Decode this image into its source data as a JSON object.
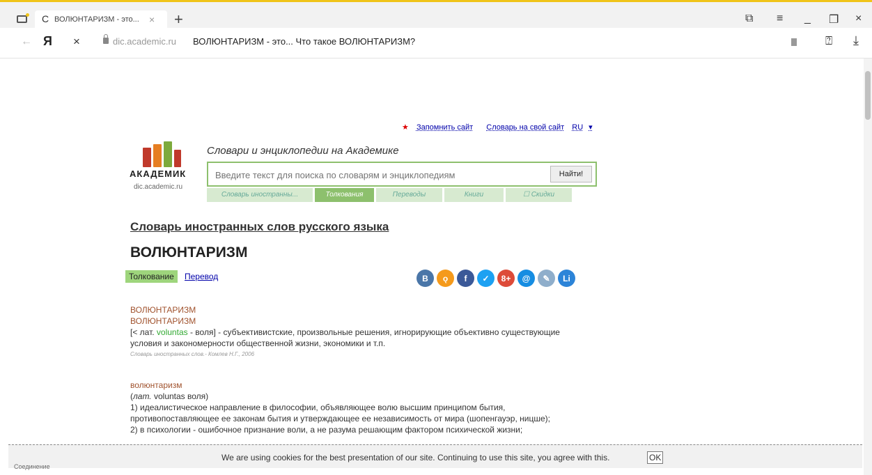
{
  "browser": {
    "tab_title": "ВОЛЮНТАРИЗМ - это...",
    "tab_initial": "С",
    "new_tab": "+",
    "yandex_logo": "Я",
    "domain": "dic.academic.ru",
    "page_title": "ВОЛЮНТАРИЗМ - это... Что такое ВОЛЮНТАРИЗМ?",
    "icons": {
      "back": "back-arrow-icon",
      "stop": "close-icon",
      "lock": "lock-icon",
      "bookmark": "bookmark-icon",
      "protect": "protect-icon",
      "download": "download-icon"
    }
  },
  "site": {
    "top_links": {
      "remember": "Запомнить сайт",
      "dictionary": "Словарь на свой сайт",
      "lang": "RU"
    },
    "logo_text": "АКАДЕМИК",
    "logo_domain": "dic.academic.ru",
    "tagline": "Словари и энциклопедии на Академике",
    "search": {
      "placeholder": "Введите текст для поиска по словарям и энциклопедиям",
      "button": "Найти!"
    },
    "search_tabs": [
      {
        "label": "Словарь иностранны..."
      },
      {
        "label": "Толкования"
      },
      {
        "label": "Переводы"
      },
      {
        "label": "Книги"
      },
      {
        "label": "☐ Скидки"
      }
    ],
    "colors": {
      "accent": "#8dc06d",
      "link": "#0000aa",
      "headword": "#a0522d"
    }
  },
  "content": {
    "dictionary_title": "Словарь иностранных слов русского языка",
    "word": "ВОЛЮНТАРИЗМ",
    "tab_interpretation": "Толкование",
    "tab_translation": "Перевод",
    "social": [
      {
        "icon": "vk-icon",
        "glyph": "B",
        "color": "#4a76a8"
      },
      {
        "icon": "odnoklassniki-icon",
        "glyph": "ǫ",
        "color": "#f59a1b"
      },
      {
        "icon": "facebook-icon",
        "glyph": "f",
        "color": "#3b5998"
      },
      {
        "icon": "twitter-icon",
        "glyph": "✓",
        "color": "#1da1f2"
      },
      {
        "icon": "googleplus-icon",
        "glyph": "8+",
        "color": "#dd4b39"
      },
      {
        "icon": "mailru-icon",
        "glyph": "@",
        "color": "#168de2"
      },
      {
        "icon": "livejournal-icon",
        "glyph": "✎",
        "color": "#8faecb"
      },
      {
        "icon": "liveinternet-icon",
        "glyph": "Li",
        "color": "#2c84d8"
      }
    ],
    "article1": {
      "headword1": "ВОЛЮНТАРИЗМ",
      "headword2": "ВОЛЮНТАРИЗМ",
      "def_prefix": "[< лат. ",
      "def_latin": "voluntas",
      "def_rest1": " - воля] - субъективистские, произвольные решения, игнорирующие объективно существующие",
      "def_rest2": "условия и закономерности общественной жизни, экономики и т.п.",
      "source": "Словарь иностранных слов.- Комлев Н.Г., 2006"
    },
    "article2": {
      "headword": "волюнтаризм",
      "etym_italic": "лат.",
      "etym_rest": " voluntas воля)",
      "line1": "1) идеалистическое направление в философии, объявляющее волю высшим принципом бытия,",
      "line2": "противопоставляющее ее законам бытия и утверждающее ее независимость от мира (шопенгауэр, ницше);",
      "line3": "2) в психологии - ошибочное признание воли, а не разума решающим фактором психической жизни;"
    }
  },
  "cookie": {
    "text": "We are using cookies for the best presentation of our site. Continuing to use this site, you agree with this.",
    "ok": "OK"
  },
  "status": "Соединение"
}
